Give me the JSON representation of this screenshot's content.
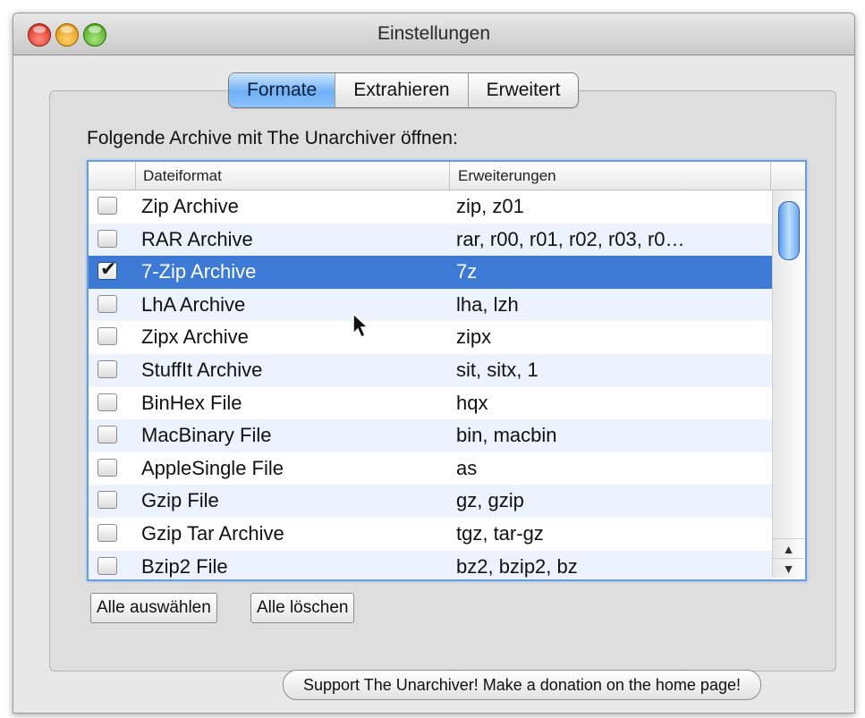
{
  "window": {
    "title": "Einstellungen"
  },
  "tabs": [
    {
      "label": "Formate",
      "active": true
    },
    {
      "label": "Extrahieren",
      "active": false
    },
    {
      "label": "Erweitert",
      "active": false
    }
  ],
  "heading": "Folgende Archive mit The Unarchiver öffnen:",
  "table": {
    "columns": {
      "format": "Dateiformat",
      "extensions": "Erweiterungen"
    },
    "rows": [
      {
        "format": "Zip Archive",
        "extensions": "zip, z01",
        "checked": false
      },
      {
        "format": "RAR Archive",
        "extensions": "rar, r00, r01, r02, r03, r0…",
        "checked": false
      },
      {
        "format": "7-Zip Archive",
        "extensions": "7z",
        "checked": true,
        "selected": true
      },
      {
        "format": "LhA Archive",
        "extensions": "lha, lzh",
        "checked": false
      },
      {
        "format": "Zipx Archive",
        "extensions": "zipx",
        "checked": false
      },
      {
        "format": "StuffIt Archive",
        "extensions": "sit, sitx, 1",
        "checked": false
      },
      {
        "format": "BinHex File",
        "extensions": "hqx",
        "checked": false
      },
      {
        "format": "MacBinary File",
        "extensions": "bin, macbin",
        "checked": false
      },
      {
        "format": "AppleSingle File",
        "extensions": "as",
        "checked": false
      },
      {
        "format": "Gzip File",
        "extensions": "gz, gzip",
        "checked": false
      },
      {
        "format": "Gzip Tar Archive",
        "extensions": "tgz, tar-gz",
        "checked": false
      },
      {
        "format": "Bzip2 File",
        "extensions": "bz2, bzip2, bz",
        "checked": false
      }
    ]
  },
  "buttons": {
    "select_all": "Alle auswählen",
    "clear_all": "Alle löschen",
    "support": "Support The Unarchiver! Make a donation on the home page!"
  },
  "colors": {
    "selection": "#3d7ad6",
    "accent": "#6b9ddc"
  },
  "icons": {
    "check": "checkmark-icon",
    "cursor": "mouse-pointer-icon"
  }
}
